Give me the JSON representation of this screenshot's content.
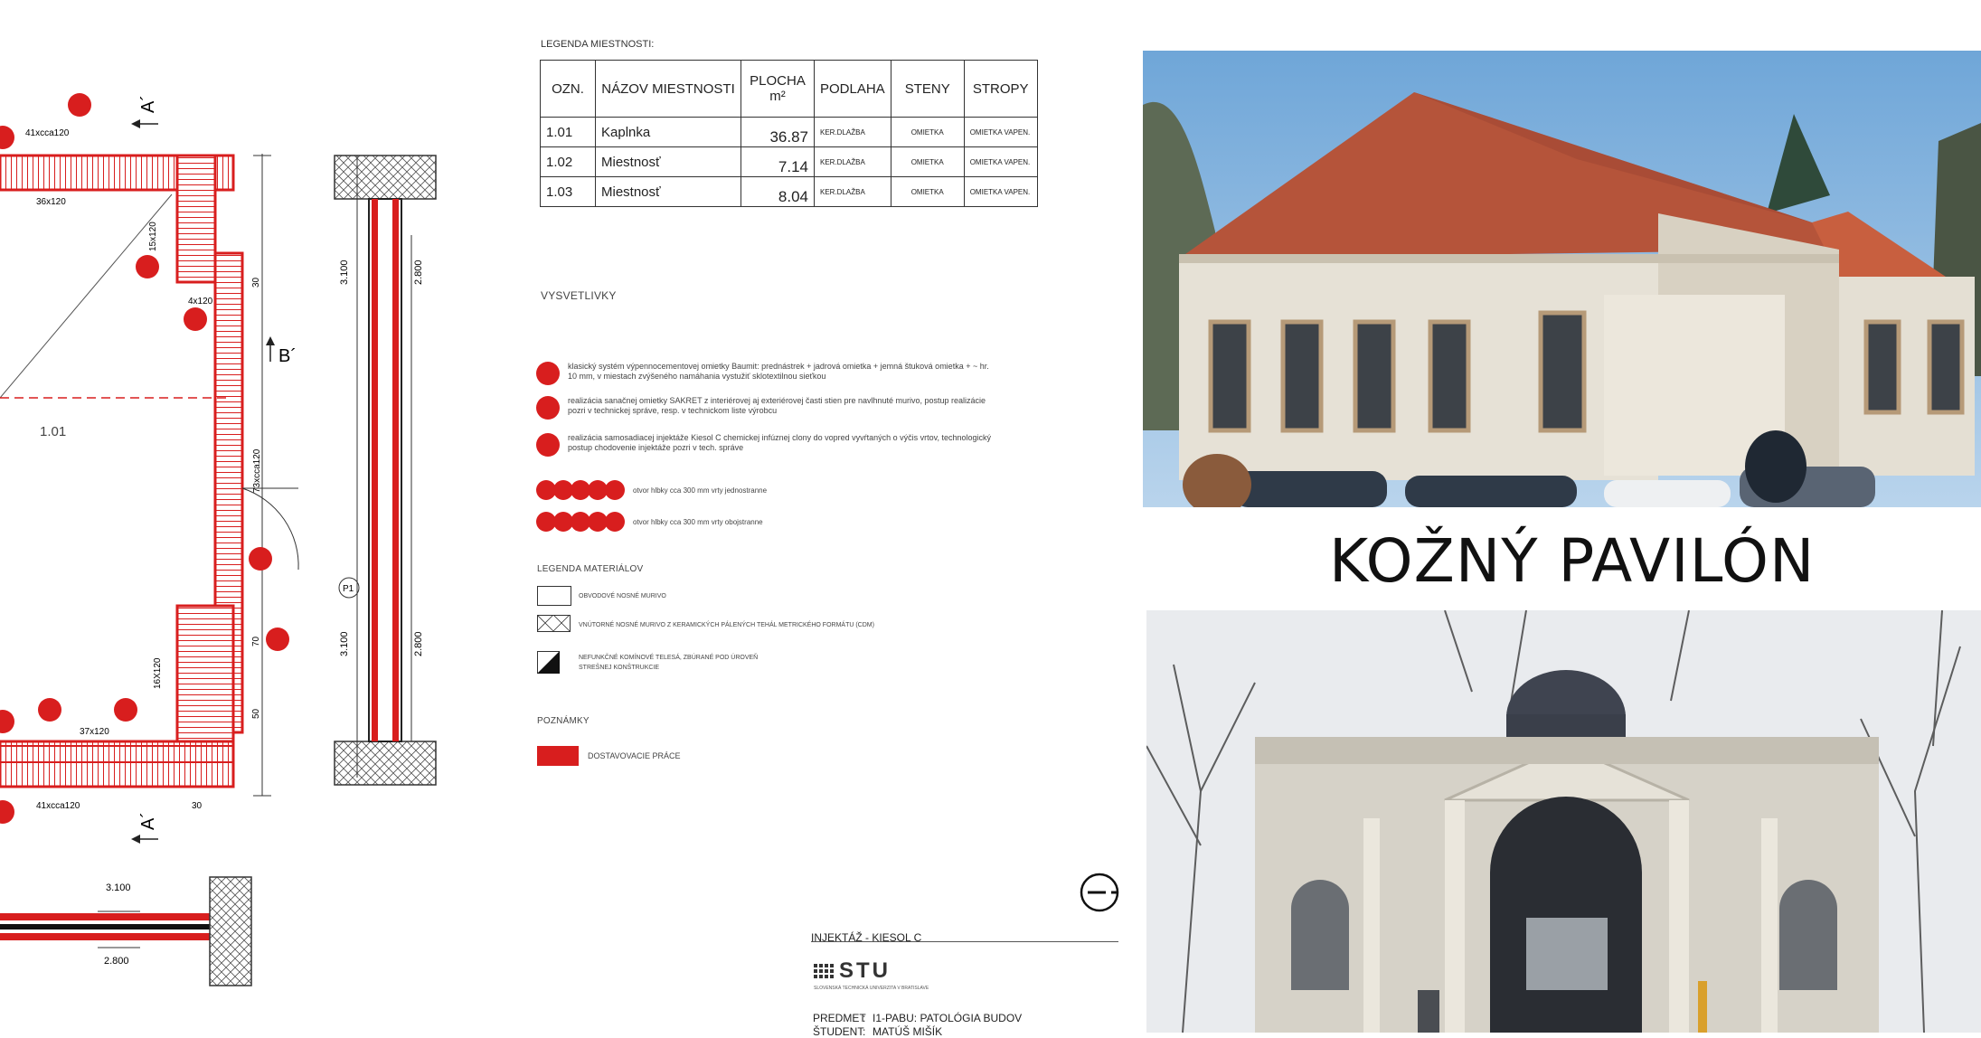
{
  "plan": {
    "axis_a_top": "A´",
    "axis_a_bottom": "A´",
    "axis_b": "B´",
    "room_label": "1.01",
    "dim_top": "41xcca120",
    "dim_top_inner": "36x120",
    "dim_right_1": "15x120",
    "dim_right_2": "4x120",
    "dim_right_3": "73xcca120",
    "dim_right_4": "16X120",
    "dim_bottom_inner": "37x120",
    "dim_bottom": "41xcca120",
    "dim_30a": "30",
    "dim_30b": "30",
    "dim_70": "70",
    "dim_50": "50",
    "level_1a": "3.100",
    "level_2a": "2.800",
    "level_1b": "3.100",
    "level_2b": "2.800",
    "marker_p1": "P1",
    "section_level_1": "3.100",
    "section_level_2": "2.800"
  },
  "room_legend": {
    "title": "LEGENDA MIESTNOSTI:",
    "headers": [
      "OZN.",
      "NÁZOV MIESTNOSTI",
      "PLOCHA m²",
      "PODLAHA",
      "STENY",
      "STROPY"
    ],
    "rows": [
      {
        "ozn": "1.01",
        "nazov": "Kaplnka",
        "plocha": "36.87",
        "podlaha": "KER.DLAŽBA",
        "steny": "OMIETKA",
        "stropy": "OMIETKA VAPEN."
      },
      {
        "ozn": "1.02",
        "nazov": "Miestnosť",
        "plocha": "7.14",
        "podlaha": "KER.DLAŽBA",
        "steny": "OMIETKA",
        "stropy": "OMIETKA VAPEN."
      },
      {
        "ozn": "1.03",
        "nazov": "Miestnosť",
        "plocha": "8.04",
        "podlaha": "KER.DLAŽBA",
        "steny": "OMIETKA",
        "stropy": "OMIETKA VAPEN."
      }
    ]
  },
  "explanations": {
    "title": "VYSVETLIVKY",
    "items": [
      "klasický systém výpennocementovej omietky Baumit: prednástrek + jadrová omietka + jemná štuková omietka + ~ hr. 10 mm, v miestach zvýšeného namáhania vystužiť sklotextilnou sieťkou",
      "realizácia sanačnej omietky SAKRET z interiérovej aj exteriérovej časti stien pre navlhnuté murivo, postup realizácie pozri v technickej správe, resp. v technickom liste výrobcu",
      "realizácia samosadiacej injektáže Kiesol C chemickej infúznej clony do vopred vyvŕtaných o výčis vrtov, technologický postup chodovenie injektáže pozri v tech. správe"
    ],
    "row_1": "otvor hlbky cca 300 mm vrty jednostranne",
    "row_2": "otvor hlbky cca 300 mm vrty obojstranne"
  },
  "materials": {
    "title": "LEGENDA MATERIÁLOV",
    "items": [
      "OBVODOVÉ NOSNÉ MURIVO",
      "VNÚTORNÉ NOSNÉ MURIVO Z KERAMICKÝCH PÁLENÝCH TEHÁL METRICKÉHO FORMÁTU (CDM)",
      "NEFUNKČNÉ KOMÍNOVÉ TELESÁ, ZBÚRANÉ POD ÚROVEŇ STREŠNEJ KONŠTRUKCIE"
    ]
  },
  "notes": {
    "title": "POZNÁMKY",
    "item": "DOSTAVOVACIE PRÁCE"
  },
  "title_block": {
    "heading": "INJEKTÁŽ - KIESOL C",
    "logo": "STU",
    "logo_sub": "SLOVENSKÁ TECHNICKÁ UNIVERZITA V BRATISLAVE",
    "subject_label": "PREDMET",
    "subject": "I1-PABU: PATOLÓGIA BUDOV",
    "student_label": "ŠTUDENT",
    "student": "MATÚŠ MIŠÍK"
  },
  "main_title": "KOŽNÝ PAVILÓN",
  "colors": {
    "accent_red": "#d81e1e",
    "ink": "#222222"
  }
}
